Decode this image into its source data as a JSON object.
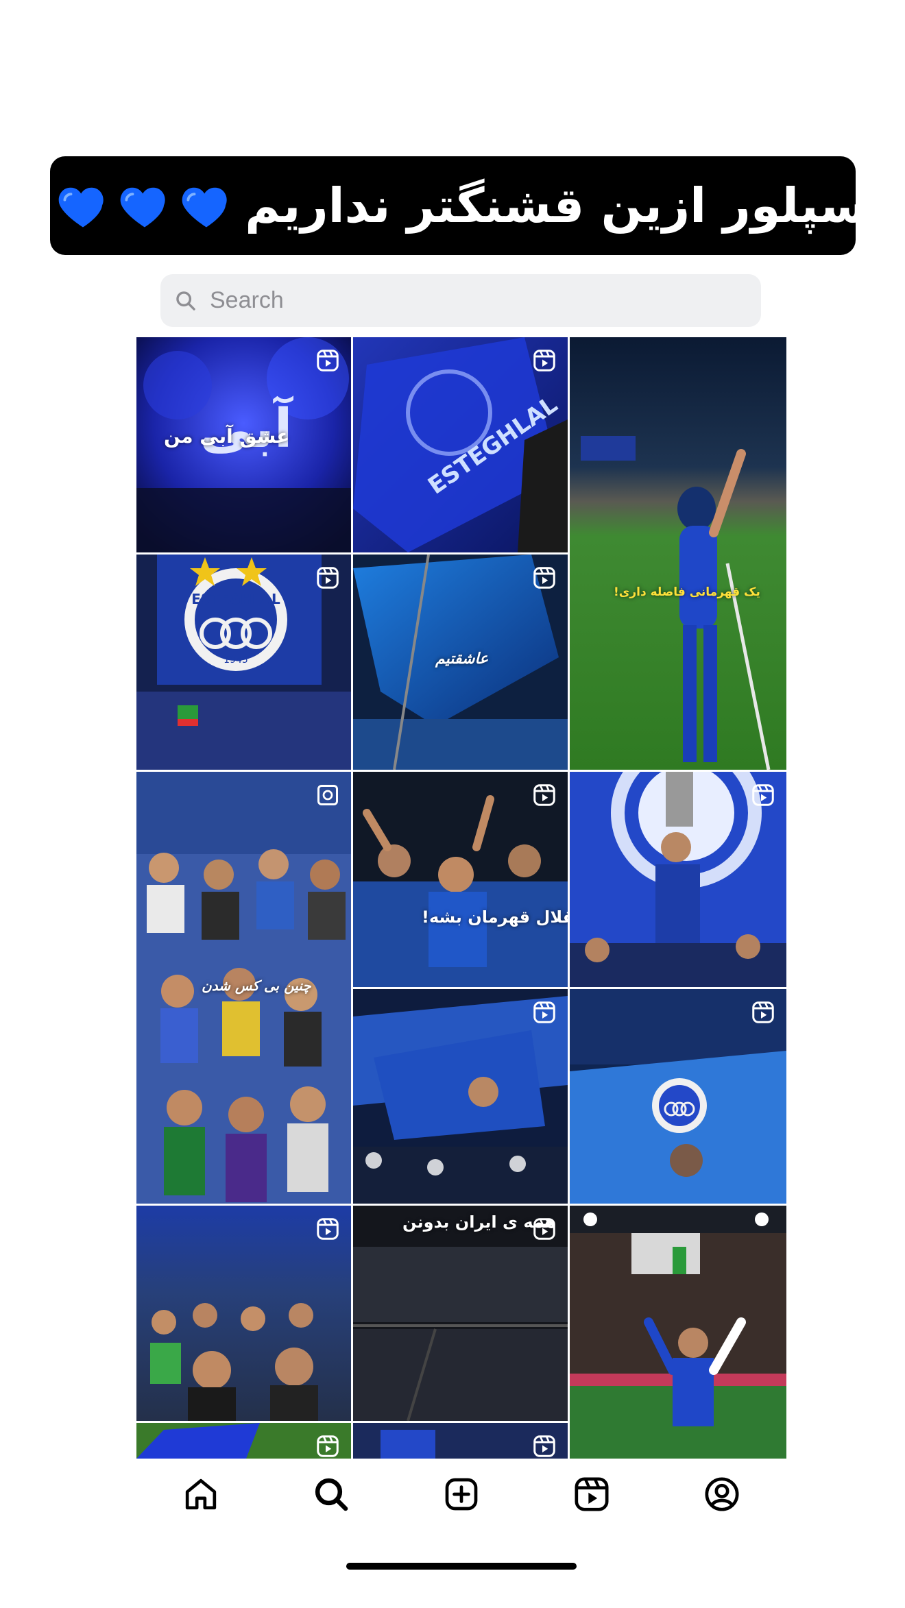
{
  "caption": {
    "text": "اکسپلور ازین قشنگتر نداریم",
    "heart_icons": [
      "blue-heart-icon",
      "blue-heart-icon",
      "blue-heart-icon",
      "blue-heart-icon"
    ],
    "heart_color": "#1565ff",
    "background": "#000000"
  },
  "search": {
    "placeholder": "Search",
    "icon": "search-icon"
  },
  "tiles": [
    {
      "overlay": "عشق آبی من",
      "badge": "reels-icon"
    },
    {
      "overlay": "ESTEGHLAL",
      "badge": "reels-icon"
    },
    {
      "overlay": "یک قهرمانی فاصله داری!",
      "badge": "none"
    },
    {
      "overlay": "ESTEGHLAL 1945",
      "badge": "reels-icon"
    },
    {
      "overlay": "عاشقتیم",
      "badge": "reels-icon"
    },
    {
      "overlay": "چنین بی کس شدن",
      "badge": "carousel-icon"
    },
    {
      "overlay": "استقلال قهرمان بشه!",
      "badge": "reels-icon"
    },
    {
      "overlay": "",
      "badge": "reels-icon"
    },
    {
      "overlay": "",
      "badge": "reels-icon"
    },
    {
      "overlay": "",
      "badge": "reels-icon"
    },
    {
      "overlay": "",
      "badge": "reels-icon"
    },
    {
      "overlay": "همه ی ایران بدونن",
      "badge": "reels-icon"
    },
    {
      "overlay": "",
      "badge": "none"
    },
    {
      "overlay": "",
      "badge": "reels-icon"
    },
    {
      "overlay": "",
      "badge": "reels-icon"
    }
  ],
  "bottom_nav": {
    "items": [
      "home-icon",
      "search-icon",
      "create-post-icon",
      "reels-icon",
      "profile-icon"
    ]
  }
}
